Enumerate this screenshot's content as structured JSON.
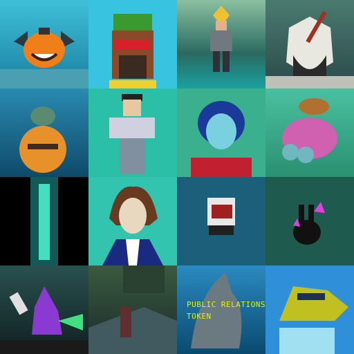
{
  "tiles": [
    {
      "subject": "pumpkin-bat",
      "background": "#2aa9c4"
    },
    {
      "subject": "pixel-strawberry-face",
      "background": "#38c3e0"
    },
    {
      "subject": "armored-warrior",
      "background": "#5a9a7a"
    },
    {
      "subject": "wolf-axe",
      "background": "#2f5e5a"
    },
    {
      "subject": "turtle-robot",
      "background": "#1e6a8c"
    },
    {
      "subject": "pixel-man",
      "background": "#2cbfa8"
    },
    {
      "subject": "alien-helmet",
      "background": "#3bb08e"
    },
    {
      "subject": "burger-frog",
      "background": "#3aa88a"
    },
    {
      "subject": "beam-figure",
      "background": "#000000"
    },
    {
      "subject": "woman-ushanka",
      "background": "#33c4b0"
    },
    {
      "subject": "voxel-dog",
      "background": "#1c5f7a"
    },
    {
      "subject": "crystal-rabbit",
      "background": "#1f5a4e"
    },
    {
      "subject": "pixel-wizard",
      "background": "#1a3a3a"
    },
    {
      "subject": "bedroom-scene",
      "background": "#1f3530"
    },
    {
      "subject": "shark",
      "background": "#1a6a9a",
      "caption": "PUBLIC RELATIONS\nTOKEN"
    },
    {
      "subject": "crocodile-sunglasses",
      "background": "#2f8fd8"
    }
  ]
}
